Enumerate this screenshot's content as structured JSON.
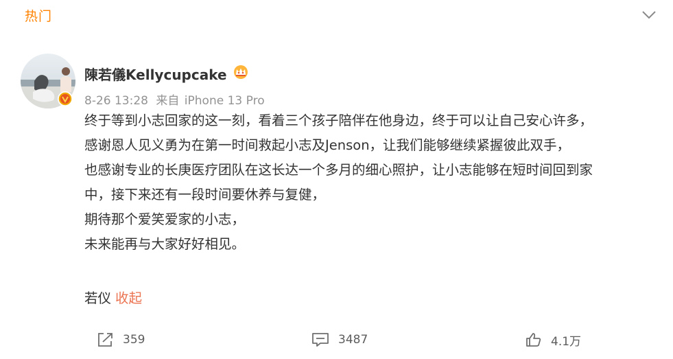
{
  "tab": {
    "label": "热门"
  },
  "icons": {
    "collapse": "chevron-down-icon",
    "verified": "verified-v-icon",
    "member": "crown-icon",
    "repost": "repost-icon",
    "comment": "comment-icon",
    "like": "like-icon"
  },
  "colors": {
    "accent": "#ff8200",
    "link": "#eb7350",
    "meta": "#939393",
    "text": "#333333"
  },
  "post": {
    "author": "陳若儀Kellycupcake",
    "time": "8-26 13:28",
    "source_label": "来自",
    "source": "iPhone 13 Pro",
    "lines": [
      "终于等到小志回家的这一刻，看着三个孩子陪伴在他身边，终于可以让自己安心许多，",
      "感谢恩人见义勇为在第一时间救起小志及Jenson，让我们能够继续紧握彼此双手，",
      "也感谢专业的长庚医疗团队在这长达一个多月的细心照护，让小志能够在短时间回到家",
      "中，接下来还有一段时间要休养与复健，",
      "期待那个爱笑爱家的小志，",
      "未来能再与大家好好相见。"
    ],
    "signature": "若仪",
    "collapse_label": "收起"
  },
  "actions": {
    "repost_count": "359",
    "comment_count": "3487",
    "like_count": "4.1万"
  }
}
